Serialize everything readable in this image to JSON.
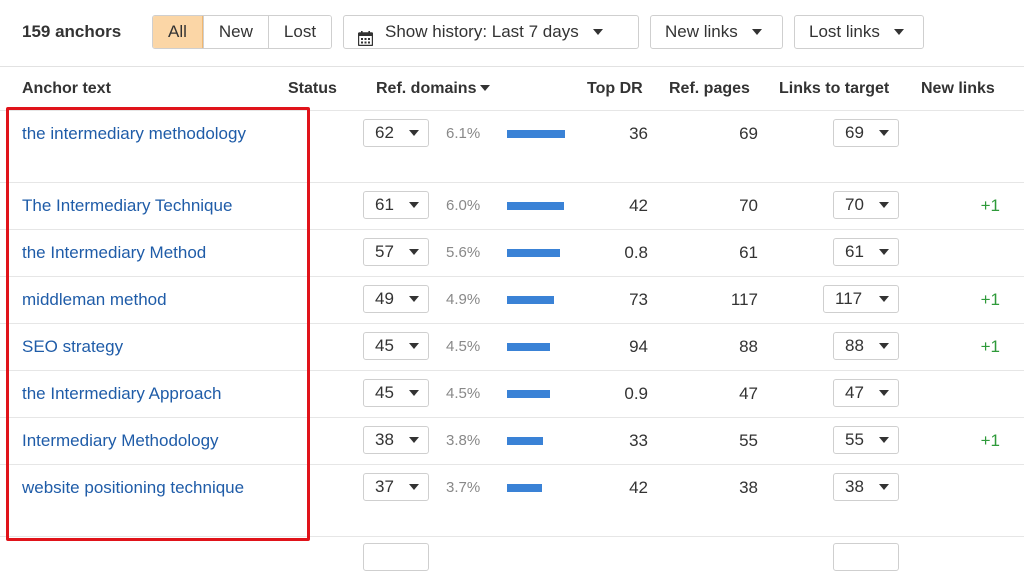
{
  "summary": {
    "count_label": "159 anchors"
  },
  "filters": {
    "segments": [
      "All",
      "New",
      "Lost"
    ],
    "active_segment": "All",
    "history_label": "Show history: Last 7 days",
    "new_links_label": "New links",
    "lost_links_label": "Lost links"
  },
  "columns": {
    "anchor_text": "Anchor text",
    "status": "Status",
    "ref_domains": "Ref. domains",
    "top_dr": "Top DR",
    "ref_pages": "Ref. pages",
    "links_to_target": "Links to target",
    "new_links": "New links"
  },
  "rows": [
    {
      "anchor": "the intermediary methodology",
      "ref_domains": "62",
      "pct": "6.1%",
      "pct_value": 6.1,
      "top_dr": "36",
      "ref_pages": "69",
      "links": "69",
      "new_links": ""
    },
    {
      "anchor": "The Intermediary Technique",
      "ref_domains": "61",
      "pct": "6.0%",
      "pct_value": 6.0,
      "top_dr": "42",
      "ref_pages": "70",
      "links": "70",
      "new_links": "+1"
    },
    {
      "anchor": "the Intermediary Method",
      "ref_domains": "57",
      "pct": "5.6%",
      "pct_value": 5.6,
      "top_dr": "0.8",
      "ref_pages": "61",
      "links": "61",
      "new_links": ""
    },
    {
      "anchor": "middleman method",
      "ref_domains": "49",
      "pct": "4.9%",
      "pct_value": 4.9,
      "top_dr": "73",
      "ref_pages": "117",
      "links": "117",
      "new_links": "+1"
    },
    {
      "anchor": "SEO strategy",
      "ref_domains": "45",
      "pct": "4.5%",
      "pct_value": 4.5,
      "top_dr": "94",
      "ref_pages": "88",
      "links": "88",
      "new_links": "+1"
    },
    {
      "anchor": "the Intermediary Approach",
      "ref_domains": "45",
      "pct": "4.5%",
      "pct_value": 4.5,
      "top_dr": "0.9",
      "ref_pages": "47",
      "links": "47",
      "new_links": ""
    },
    {
      "anchor": "Intermediary Methodology",
      "ref_domains": "38",
      "pct": "3.8%",
      "pct_value": 3.8,
      "top_dr": "33",
      "ref_pages": "55",
      "links": "55",
      "new_links": "+1"
    },
    {
      "anchor": "website positioning technique",
      "ref_domains": "37",
      "pct": "3.7%",
      "pct_value": 3.7,
      "top_dr": "42",
      "ref_pages": "38",
      "links": "38",
      "new_links": ""
    }
  ],
  "colors": {
    "link": "#1f5ca8",
    "bar": "#3a82d6",
    "active_segment": "#fbd6a6",
    "new_links_positive": "#2e9a3a",
    "highlight_box": "#e0131a"
  },
  "icons": {
    "history": "calendar-icon",
    "dropdown": "caret-down-icon"
  }
}
